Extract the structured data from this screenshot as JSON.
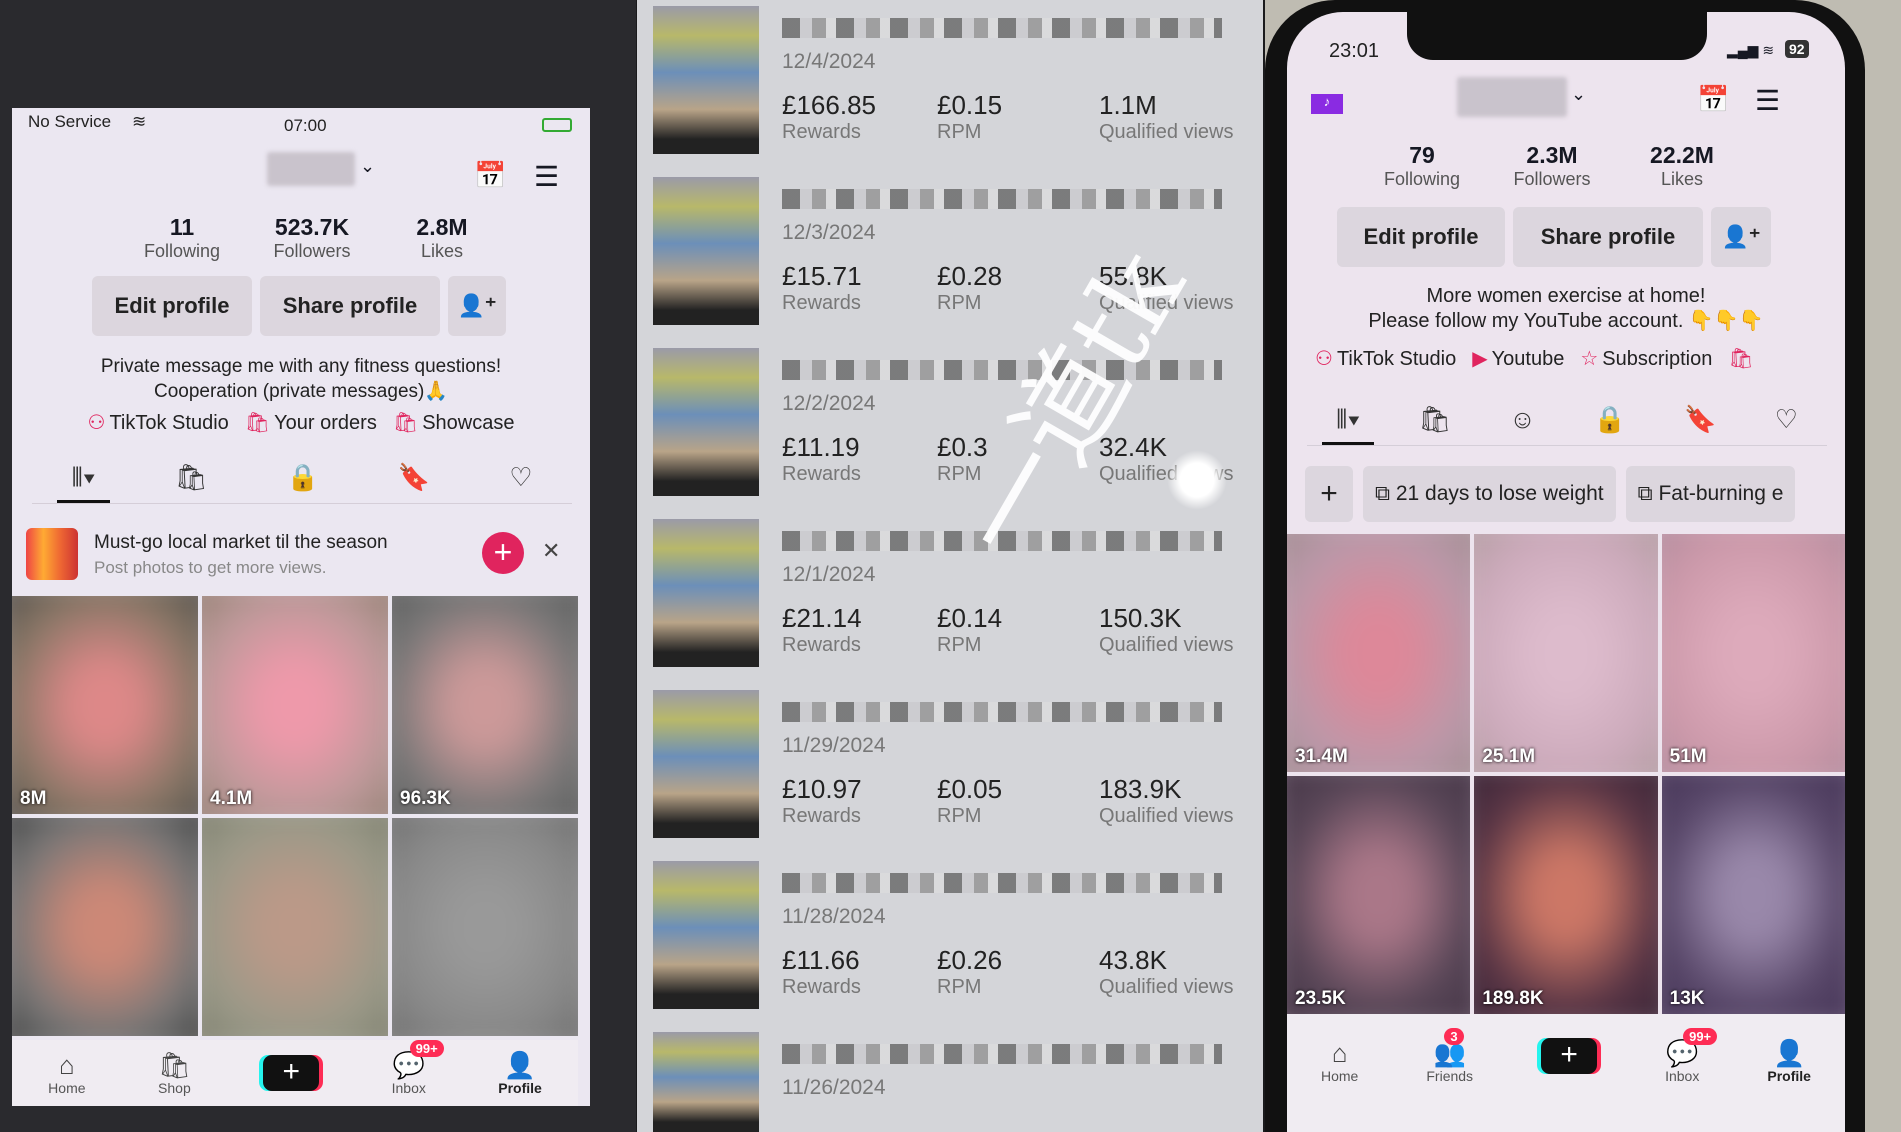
{
  "left_phone": {
    "status": {
      "carrier": "No Service",
      "time": "07:00"
    },
    "stats": [
      {
        "value": "11",
        "label": "Following"
      },
      {
        "value": "523.7K",
        "label": "Followers"
      },
      {
        "value": "2.8M",
        "label": "Likes"
      }
    ],
    "buttons": {
      "edit": "Edit profile",
      "share": "Share profile"
    },
    "bio": [
      "Private message me with any fitness questions!",
      "Cooperation (private messages)🙏"
    ],
    "links": [
      "TikTok Studio",
      "Your orders",
      "Showcase"
    ],
    "promo": {
      "title": "Must-go local market til the season",
      "subtitle": "Post photos to get more views."
    },
    "videos": [
      {
        "views": "8M"
      },
      {
        "views": "4.1M"
      },
      {
        "views": "96.3K"
      },
      {
        "views": ""
      },
      {
        "views": ""
      },
      {
        "views": ""
      }
    ],
    "nav": {
      "home": "Home",
      "shop": "Shop",
      "inbox": "Inbox",
      "inbox_badge": "99+",
      "profile": "Profile"
    }
  },
  "earnings": {
    "rows": [
      {
        "date": "12/4/2024",
        "rewards": "£166.85",
        "rewards_label": "Rewards",
        "rpm": "£0.15",
        "rpm_label": "RPM",
        "views": "1.1M",
        "views_label": "Qualified views"
      },
      {
        "date": "12/3/2024",
        "rewards": "£15.71",
        "rewards_label": "Rewards",
        "rpm": "£0.28",
        "rpm_label": "RPM",
        "views": "55.8K",
        "views_label": "Qualified views"
      },
      {
        "date": "12/2/2024",
        "rewards": "£11.19",
        "rewards_label": "Rewards",
        "rpm": "£0.3",
        "rpm_label": "RPM",
        "views": "32.4K",
        "views_label": "Qualified views"
      },
      {
        "date": "12/1/2024",
        "rewards": "£21.14",
        "rewards_label": "Rewards",
        "rpm": "£0.14",
        "rpm_label": "RPM",
        "views": "150.3K",
        "views_label": "Qualified views"
      },
      {
        "date": "11/29/2024",
        "rewards": "£10.97",
        "rewards_label": "Rewards",
        "rpm": "£0.05",
        "rpm_label": "RPM",
        "views": "183.9K",
        "views_label": "Qualified views"
      },
      {
        "date": "11/28/2024",
        "rewards": "£11.66",
        "rewards_label": "Rewards",
        "rpm": "£0.26",
        "rpm_label": "RPM",
        "views": "43.8K",
        "views_label": "Qualified views"
      },
      {
        "date": "11/26/2024"
      }
    ],
    "watermark": "一道tk"
  },
  "right_phone": {
    "status": {
      "time": "23:01",
      "battery": "92"
    },
    "stats": [
      {
        "value": "79",
        "label": "Following"
      },
      {
        "value": "2.3M",
        "label": "Followers"
      },
      {
        "value": "22.2M",
        "label": "Likes"
      }
    ],
    "buttons": {
      "edit": "Edit profile",
      "share": "Share profile"
    },
    "bio": [
      "More women exercise at home!",
      "Please follow my YouTube account. 👇👇👇"
    ],
    "links": [
      "TikTok Studio",
      "Youtube",
      "Subscription"
    ],
    "playlists": [
      "21 days to lose weight",
      "Fat-burning e"
    ],
    "videos": [
      {
        "views": "31.4M"
      },
      {
        "views": "25.1M"
      },
      {
        "views": "51M"
      },
      {
        "views": "23.5K"
      },
      {
        "views": "189.8K"
      },
      {
        "views": "13K"
      }
    ],
    "nav": {
      "home": "Home",
      "friends": "Friends",
      "friends_badge": "3",
      "inbox": "Inbox",
      "inbox_badge": "99+",
      "profile": "Profile"
    }
  },
  "colors": {
    "accent": "#fe2c55",
    "tiktok_cyan": "#25f4ee",
    "background": "#ece6f0"
  }
}
